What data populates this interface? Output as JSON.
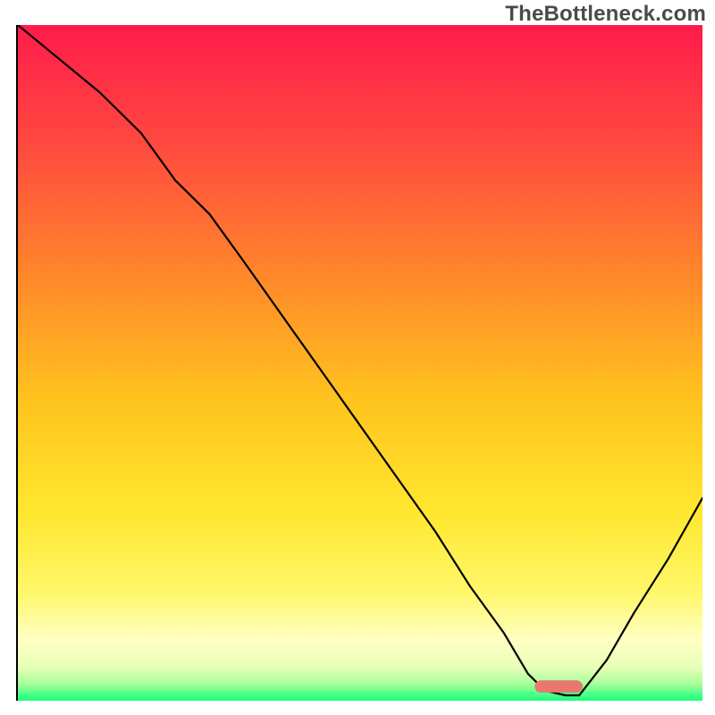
{
  "watermark": "TheBottleneck.com",
  "colors": {
    "curve": "#000000",
    "marker": "#e8776f",
    "gradient_stops": [
      {
        "offset": 0.0,
        "hex": "#ff1b4b"
      },
      {
        "offset": 0.18,
        "hex": "#ff4a3f"
      },
      {
        "offset": 0.38,
        "hex": "#ff8a2a"
      },
      {
        "offset": 0.55,
        "hex": "#ffc21e"
      },
      {
        "offset": 0.72,
        "hex": "#ffe72e"
      },
      {
        "offset": 0.84,
        "hex": "#fff76a"
      },
      {
        "offset": 0.91,
        "hex": "#ffffc2"
      },
      {
        "offset": 0.95,
        "hex": "#e8ffb8"
      },
      {
        "offset": 0.975,
        "hex": "#a8ff9a"
      },
      {
        "offset": 1.0,
        "hex": "#17ff7e"
      }
    ]
  },
  "chart_data": {
    "type": "line",
    "title": "",
    "xlabel": "",
    "ylabel": "",
    "xlim": [
      0,
      100
    ],
    "ylim": [
      0,
      100
    ],
    "x": [
      0,
      6,
      12,
      18,
      23,
      28,
      33,
      40,
      47,
      54,
      61,
      66,
      71,
      74.5,
      77,
      80,
      82,
      86,
      90,
      95,
      100
    ],
    "values": [
      100,
      95,
      90,
      84,
      77,
      72,
      65,
      55,
      45,
      35,
      25,
      17,
      10,
      4,
      1.5,
      0.8,
      0.8,
      6,
      13,
      21,
      30
    ],
    "optimum_marker": {
      "x_center": 79,
      "x_width": 7,
      "y": 1.2,
      "height": 1.8
    }
  }
}
